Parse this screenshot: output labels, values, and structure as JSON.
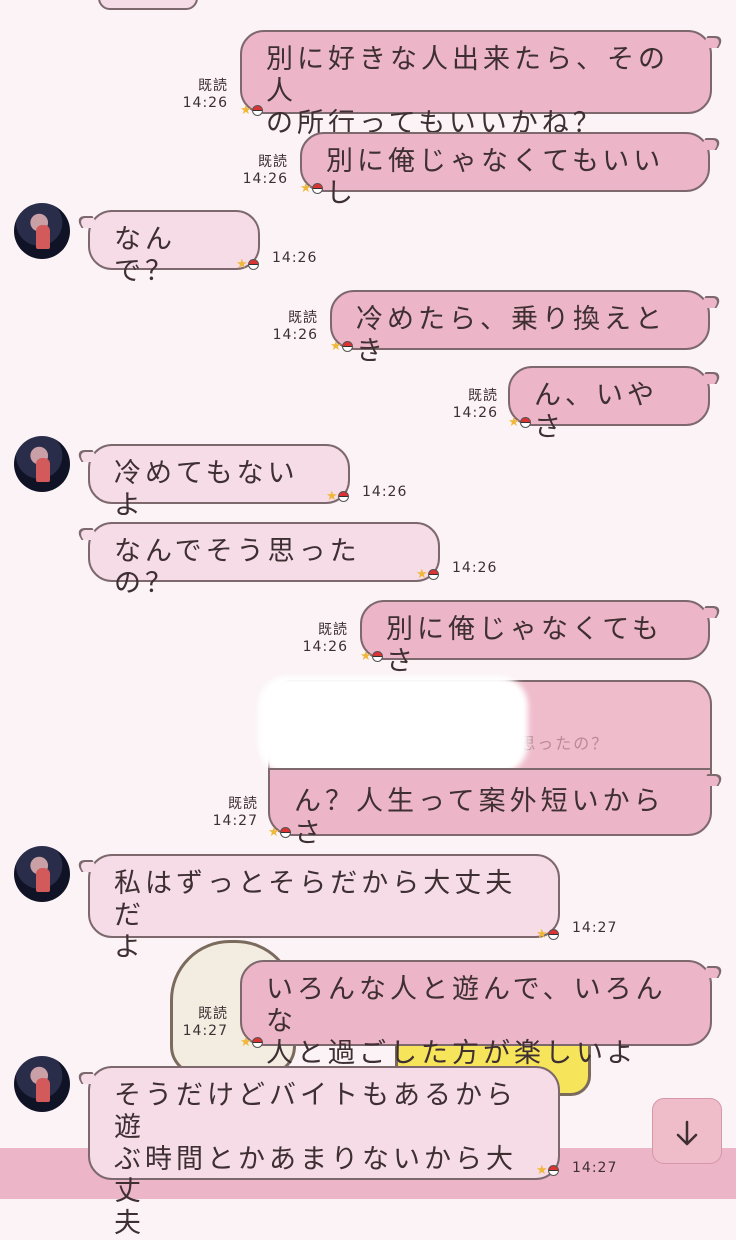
{
  "read_label": "既読",
  "messages": [
    {
      "text": "別に好きな人出来たら、その人\nの所行ってもいいかね？",
      "time": "14:26"
    },
    {
      "text": "別に俺じゃなくてもいいし",
      "time": "14:26"
    },
    {
      "text": "なんで？",
      "time": "14:26"
    },
    {
      "text": "冷めたら、乗り換えとき",
      "time": "14:26"
    },
    {
      "text": "ん、いやさ",
      "time": "14:26"
    },
    {
      "text": "冷めてもないよ",
      "time": "14:26"
    },
    {
      "text": "なんでそう思ったの？",
      "time": "14:26"
    },
    {
      "text": "別に俺じゃなくてもさ",
      "time": "14:26"
    },
    {
      "text": "ん？人生って案外短いからさ",
      "time": "14:27",
      "quoted": "なんでそう思ったの？"
    },
    {
      "text": "私はずっとそらだから大丈夫だ\nよ",
      "time": "14:27"
    },
    {
      "text": "いろんな人と遊んで、いろんな\n人と過ごした方が楽しいよ",
      "time": "14:27"
    },
    {
      "text": "そうだけどバイトもあるから遊\nぶ時間とかあまりないから大丈\n夫",
      "time": "14:27"
    }
  ],
  "quote_visible": "なんでそう思ったの？",
  "scroll_down_icon": "arrow-down-icon",
  "colors": {
    "background": "#fbf3f6",
    "my_bubble": "#edb6c8",
    "their_bubble": "#f6dce7",
    "border": "#7d686e"
  }
}
